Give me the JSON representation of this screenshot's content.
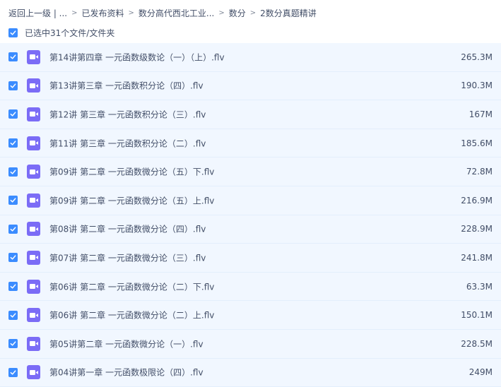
{
  "breadcrumb": [
    {
      "label": "返回上一级 | ..."
    },
    {
      "label": "已发布资料"
    },
    {
      "label": "数分高代西北工业..."
    },
    {
      "label": "数分"
    },
    {
      "label": "2数分真题精讲"
    }
  ],
  "breadcrumb_separator": ">",
  "selection": {
    "label": "已选中31个文件/文件夹",
    "checked": true
  },
  "icons": {
    "checkbox": "checkmark-icon",
    "file": "video-file-icon"
  },
  "colors": {
    "accent": "#3b8cff",
    "video_icon": "#7b6cf6",
    "row_selected_bg": "#f1f7ff"
  },
  "files": [
    {
      "name": "第14讲第四章 一元函数级数论（一）（上）.flv",
      "size": "265.3M",
      "checked": true
    },
    {
      "name": "第13讲第三章 一元函数积分论（四）.flv",
      "size": "190.3M",
      "checked": true
    },
    {
      "name": "第12讲 第三章 一元函数积分论（三）.flv",
      "size": "167M",
      "checked": true
    },
    {
      "name": "第11讲 第三章 一元函数积分论（二）.flv",
      "size": "185.6M",
      "checked": true
    },
    {
      "name": "第09讲 第二章 一元函数微分论（五）下.flv",
      "size": "72.8M",
      "checked": true
    },
    {
      "name": "第09讲 第二章 一元函数微分论（五）上.flv",
      "size": "216.9M",
      "checked": true
    },
    {
      "name": "第08讲 第二章 一元函数微分论（四）.flv",
      "size": "228.9M",
      "checked": true
    },
    {
      "name": "第07讲 第二章 一元函数微分论（三）.flv",
      "size": "241.8M",
      "checked": true
    },
    {
      "name": "第06讲 第二章 一元函数微分论（二）下.flv",
      "size": "63.3M",
      "checked": true
    },
    {
      "name": "第06讲 第二章 一元函数微分论（二）上.flv",
      "size": "150.1M",
      "checked": true
    },
    {
      "name": "第05讲第二章 一元函数微分论（一）.flv",
      "size": "228.5M",
      "checked": true
    },
    {
      "name": "第04讲第一章 一元函数极限论（四）.flv",
      "size": "249M",
      "checked": true
    }
  ]
}
